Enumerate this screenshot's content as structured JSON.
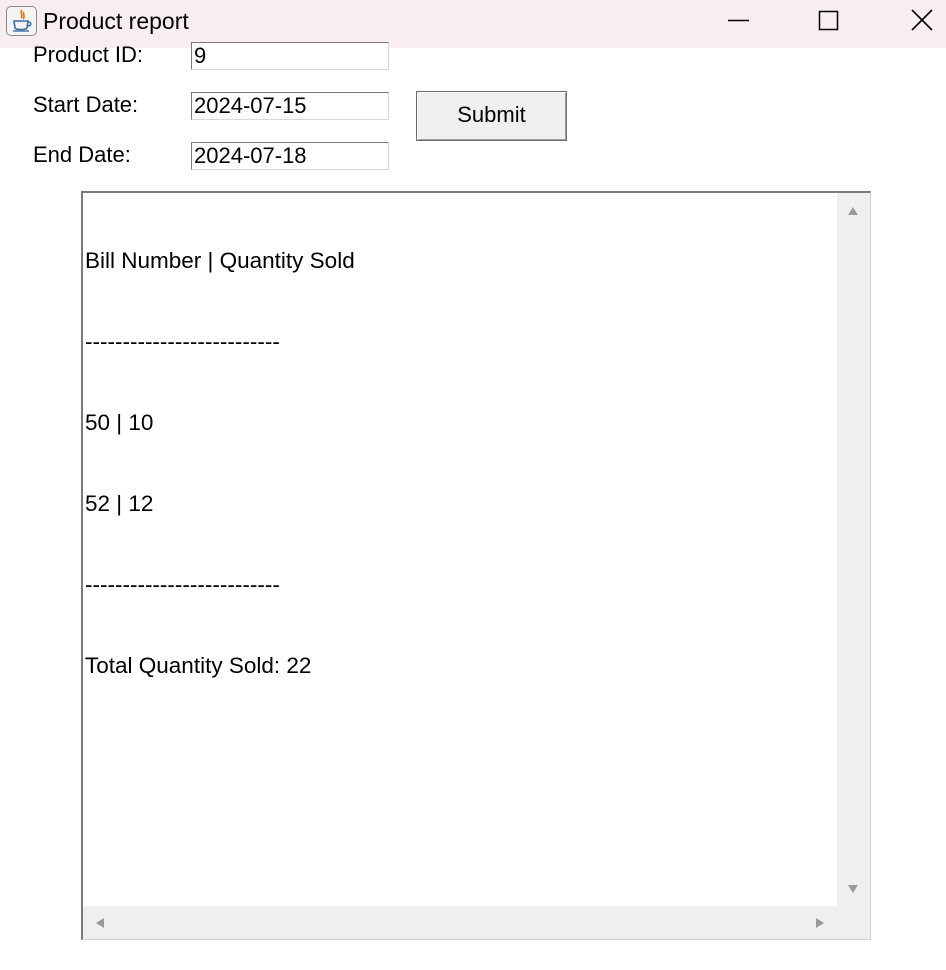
{
  "window": {
    "title": "Product report",
    "app_icon": "java-icon",
    "controls": {
      "minimize_icon": "minimize-icon",
      "maximize_icon": "maximize-icon",
      "close_icon": "close-icon"
    }
  },
  "form": {
    "product_id_label": "Product ID:",
    "product_id_value": "9",
    "start_date_label": "Start Date:",
    "start_date_value": "2024-07-15",
    "end_date_label": "End Date:",
    "end_date_value": "2024-07-18",
    "submit_label": "Submit"
  },
  "report": {
    "header": "Bill Number | Quantity Sold",
    "separator_top": "--------------------------",
    "rows": [
      "50 | 10",
      "52 | 12"
    ],
    "separator_bottom": "--------------------------",
    "total": "Total Quantity Sold: 22"
  },
  "colors": {
    "titlebar_bg": "#f9eeef",
    "scrollbar_bg": "#efefef",
    "button_bg": "#efefef"
  }
}
